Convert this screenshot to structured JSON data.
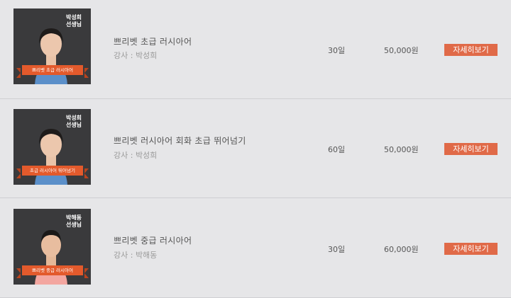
{
  "courses": [
    {
      "thumb_name": "박성희\n선생님",
      "thumb_ribbon": "쁘리벳 초급 러시아어",
      "title": "쁘리벳 초급 러시아어",
      "teacher": "강사 : 박성희",
      "days": "30일",
      "price": "50,000원",
      "button": "자세히보기"
    },
    {
      "thumb_name": "박성희\n선생님",
      "thumb_ribbon": "초급 러시아어 뛰어넘기",
      "title": "쁘리벳 러시아어 회화 초급 뛰어넘기",
      "teacher": "강사 : 박성희",
      "days": "60일",
      "price": "50,000원",
      "button": "자세히보기"
    },
    {
      "thumb_name": "박해동\n선생님",
      "thumb_ribbon": "쁘리벳 중급 러시아어",
      "title": "쁘리벳 중급 러시아어",
      "teacher": "강사 : 박해동",
      "days": "30일",
      "price": "60,000원",
      "button": "자세히보기"
    }
  ],
  "colors": {
    "background": "#e6e6e8",
    "button": "#e06a48",
    "ribbon": "#e35a2c",
    "thumb_bg": "#3a3a3c"
  }
}
